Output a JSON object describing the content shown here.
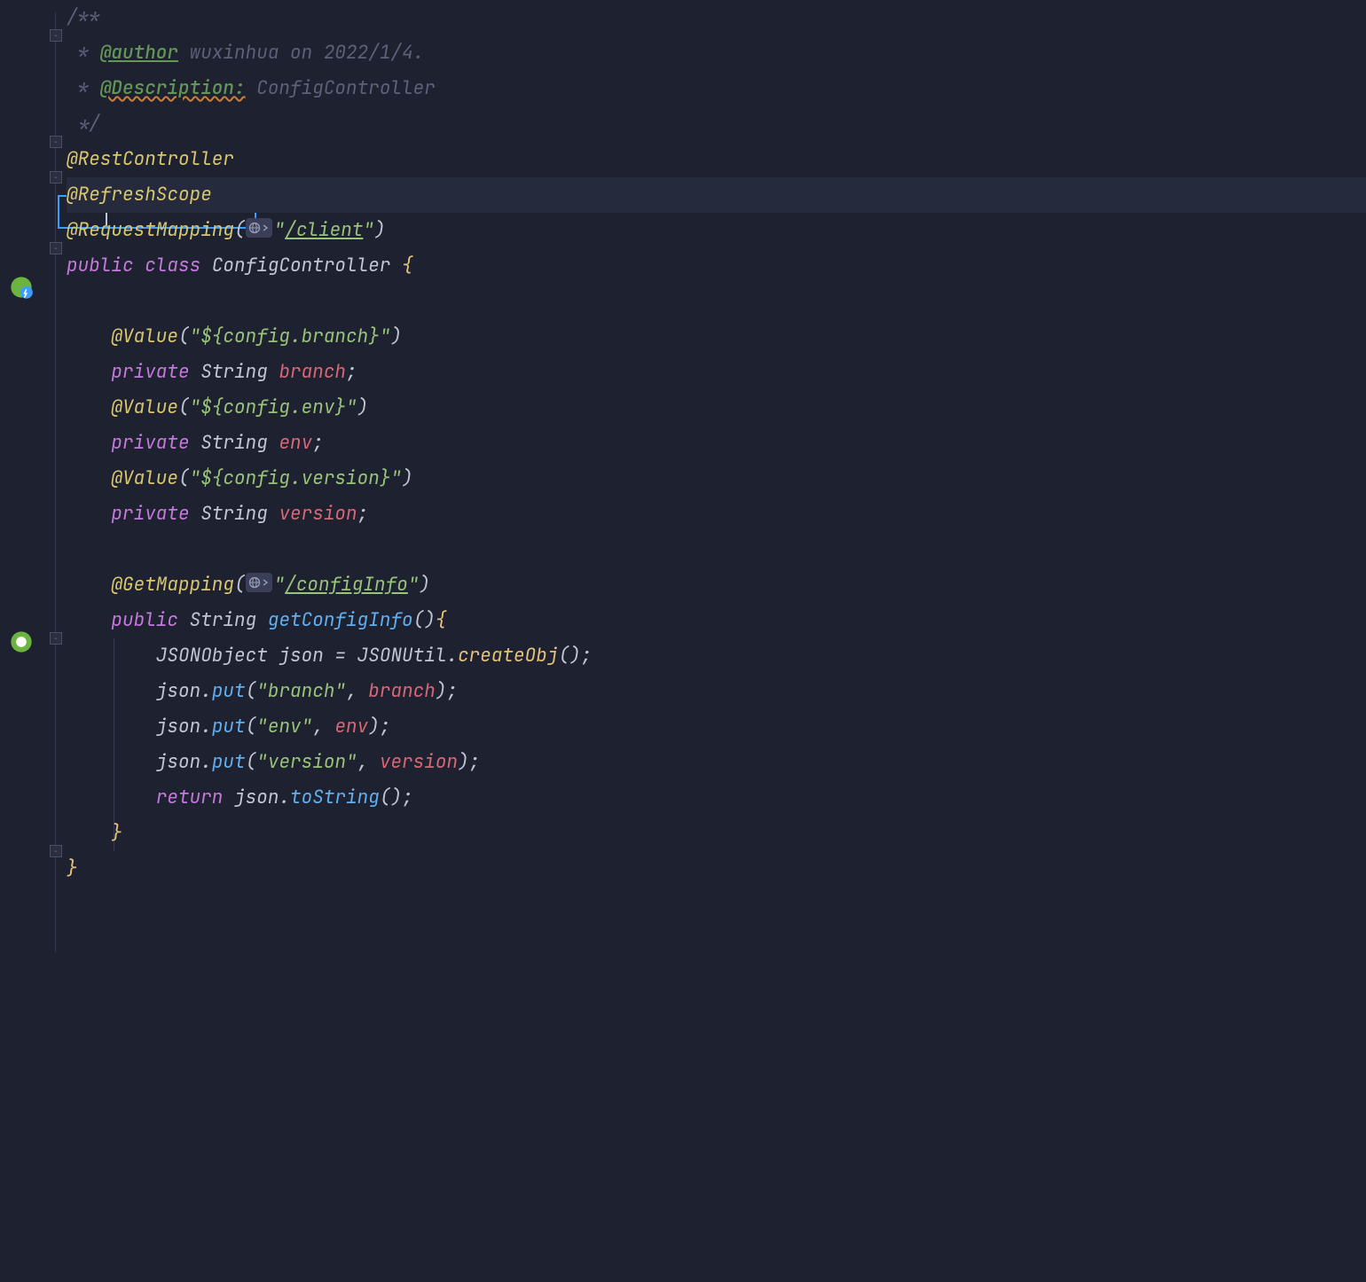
{
  "code": {
    "comment_open": "/**",
    "author_prefix": " * ",
    "author_tag": "@author",
    "author_text": " wuxinhua on 2022/1/4.",
    "desc_prefix": " * ",
    "desc_tag": "@Description:",
    "desc_text": " ConfigController",
    "comment_close": " */",
    "anno_rest": "@RestController",
    "anno_refresh": "@RefreshScope",
    "anno_reqmap": "@RequestMapping",
    "reqmap_path": "/client",
    "kw_public": "public",
    "kw_class": "class",
    "class_name": "ConfigController",
    "anno_value": "@Value",
    "val_branch": "\"${config.branch}\"",
    "val_env": "\"${config.env}\"",
    "val_version": "\"${config.version}\"",
    "kw_private": "private",
    "type_string": "String",
    "field_branch": "branch",
    "field_env": "env",
    "field_version": "version",
    "anno_getmap": "@GetMapping",
    "getmap_path": "/configInfo",
    "method_name": "getConfigInfo",
    "type_jsonobj": "JSONObject",
    "var_json": "json",
    "type_jsonutil": "JSONUtil",
    "m_createObj": "createObj",
    "m_put": "put",
    "str_branch": "\"branch\"",
    "str_env": "\"env\"",
    "str_version": "\"version\"",
    "kw_return": "return",
    "m_toString": "toString",
    "q": "\"",
    "op": "(",
    "cp": ")",
    "ob": "{",
    "cb": "}",
    "semi": ";",
    "comma": ", ",
    "dot": ".",
    "eq": " = ",
    "sp": " "
  }
}
